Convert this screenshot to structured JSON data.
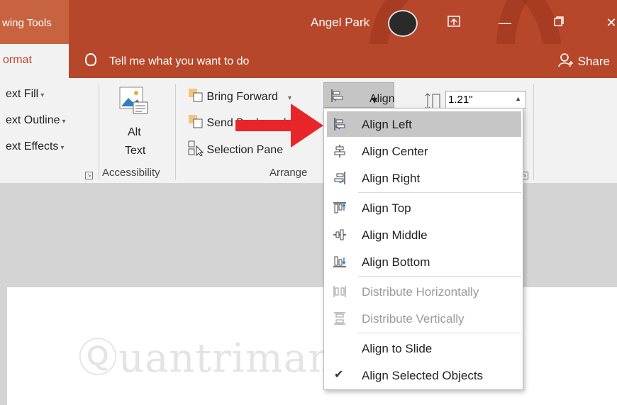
{
  "titlebar": {
    "context_label": "wing Tools",
    "user_name": "Angel Park",
    "colors": {
      "bar": "#b7472a",
      "context_tab": "#c8633f"
    }
  },
  "tabs": {
    "active_tab": "ormat",
    "tell_me": "Tell me what you want to do",
    "share": "Share"
  },
  "ribbon": {
    "wordart": {
      "text_fill": "ext Fill",
      "text_outline": "ext Outline",
      "text_effects": "ext Effects"
    },
    "accessibility": {
      "alt_line1": "Alt",
      "alt_line2": "Text",
      "group_label": "Accessibility"
    },
    "arrange": {
      "bring_forward": "Bring Forward",
      "send_backward": "Send Backward",
      "selection_pane": "Selection Pane",
      "align": "Align",
      "group_label": "Arrange"
    },
    "size": {
      "height_value": "1.21\""
    }
  },
  "align_menu": {
    "items": [
      {
        "label": "Align Left",
        "icon": "align-left-icon",
        "highlighted": true,
        "disabled": false
      },
      {
        "label": "Align Center",
        "icon": "align-center-icon",
        "highlighted": false,
        "disabled": false
      },
      {
        "label": "Align Right",
        "icon": "align-right-icon",
        "highlighted": false,
        "disabled": false
      },
      {
        "label": "Align Top",
        "icon": "align-top-icon",
        "highlighted": false,
        "disabled": false
      },
      {
        "label": "Align Middle",
        "icon": "align-middle-icon",
        "highlighted": false,
        "disabled": false
      },
      {
        "label": "Align Bottom",
        "icon": "align-bottom-icon",
        "highlighted": false,
        "disabled": false
      },
      {
        "label": "Distribute Horizontally",
        "icon": "distribute-horizontally-icon",
        "highlighted": false,
        "disabled": true
      },
      {
        "label": "Distribute Vertically",
        "icon": "distribute-vertically-icon",
        "highlighted": false,
        "disabled": true
      },
      {
        "label": "Align to Slide",
        "icon": "",
        "highlighted": false,
        "disabled": false
      },
      {
        "label": "Align Selected Objects",
        "icon": "checkmark-icon",
        "highlighted": false,
        "disabled": false,
        "checked": true
      }
    ]
  },
  "annotation": {
    "arrow_color": "#e8262a"
  }
}
